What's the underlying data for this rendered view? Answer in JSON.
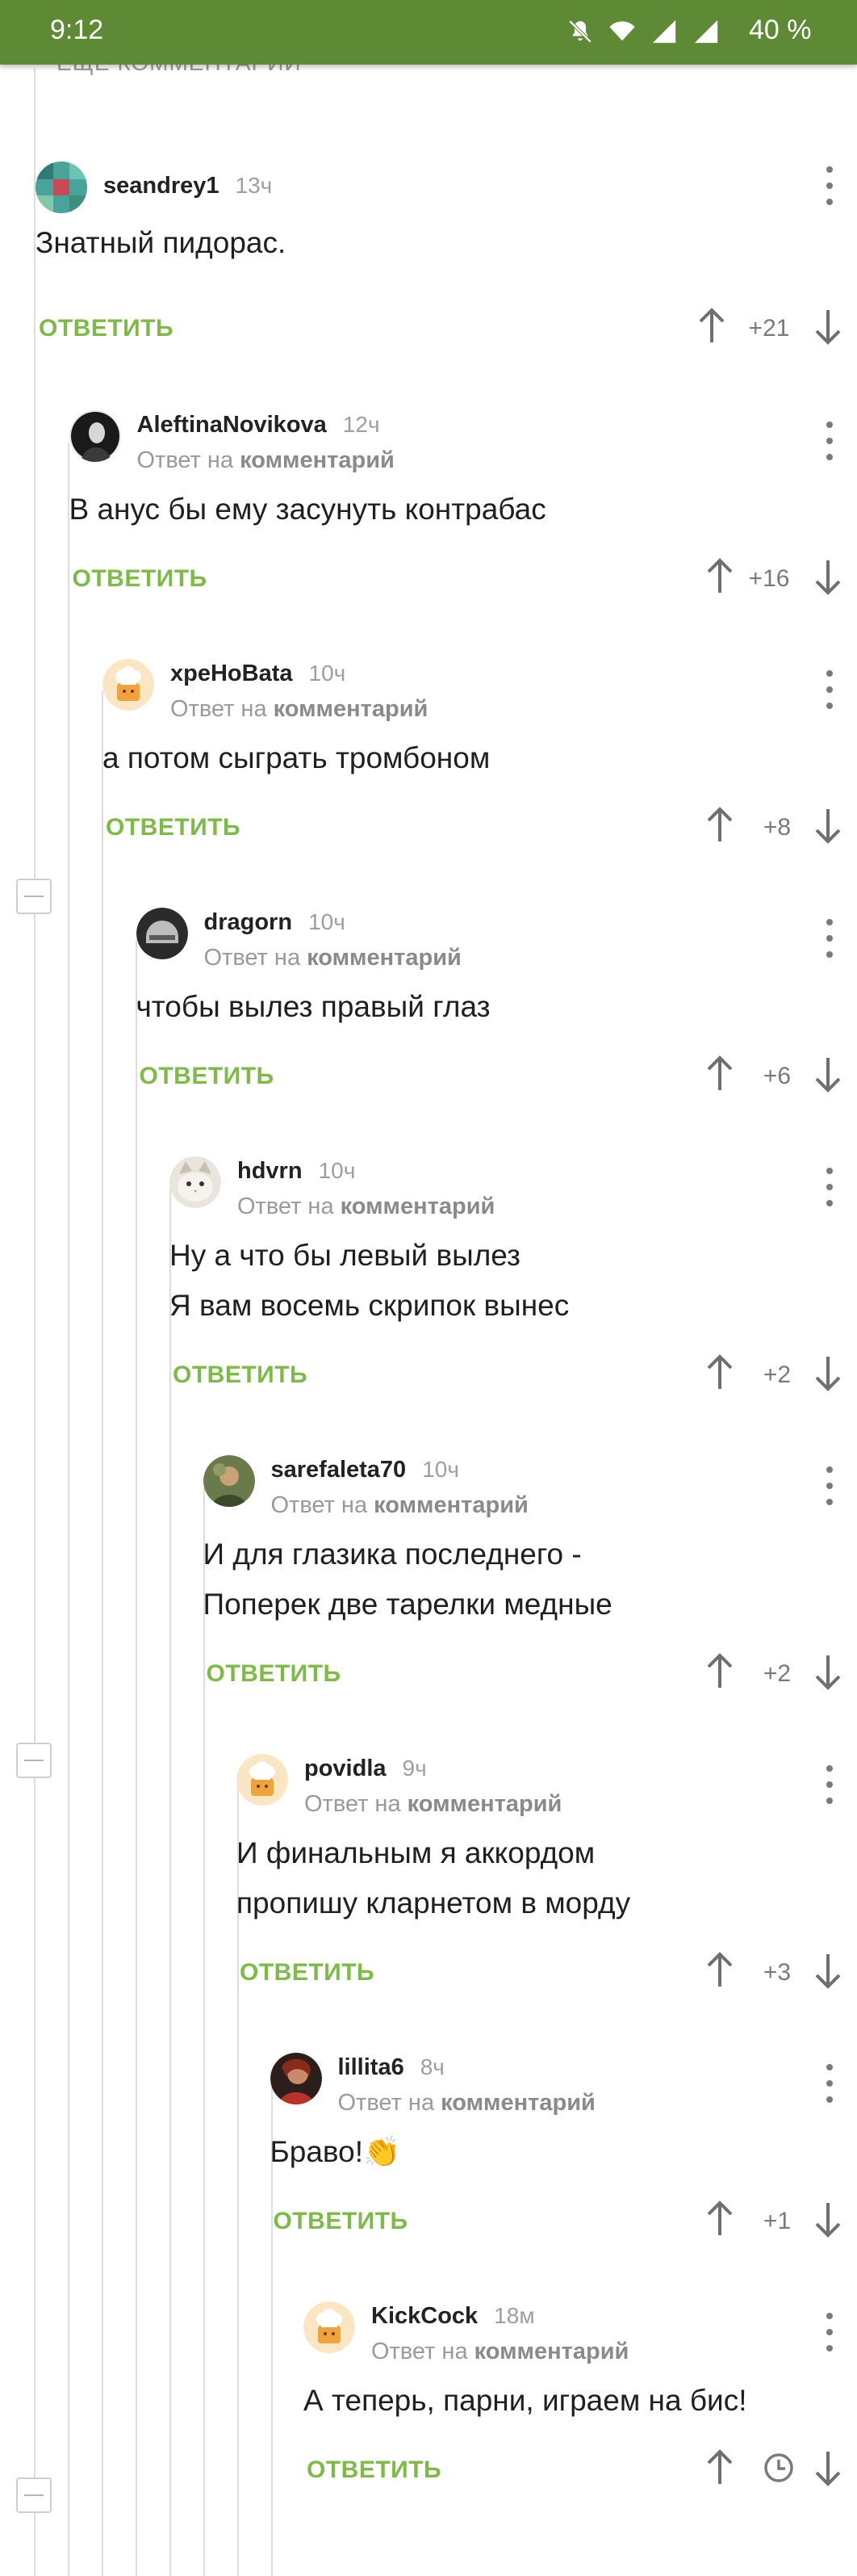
{
  "status_bar": {
    "time": "9:12",
    "battery": "40 %"
  },
  "previous": {
    "more_label": "ЕЩЕ КОММЕНТАРИИ"
  },
  "labels": {
    "reply": "ОТВЕТИТЬ",
    "reply_prefix": "Ответ на",
    "reply_target": "комментарий"
  },
  "colors": {
    "brand_green": "#5e8a35",
    "accent_green": "#7dbb46",
    "thread_line": "#dddddd"
  },
  "comments": [
    {
      "username": "seandrey1",
      "time": "13ч",
      "reply_to": false,
      "text": [
        "Знатный пидорас."
      ],
      "score": "+21",
      "avatar": "mosaic-avatar"
    },
    {
      "username": "AleftinaNovikova",
      "time": "12ч",
      "reply_to": true,
      "text": [
        "В анус бы ему засунуть контрабас"
      ],
      "score": "+16",
      "avatar": "dark-figure-avatar"
    },
    {
      "username": "xpeHoBata",
      "time": "10ч",
      "reply_to": true,
      "text": [
        "а потом сыграть тромбоном"
      ],
      "score": "+8",
      "avatar": "default-chef-avatar"
    },
    {
      "username": "dragorn",
      "time": "10ч",
      "reply_to": true,
      "text": [
        "чтобы вылез правый глаз"
      ],
      "score": "+6",
      "avatar": "helmet-avatar"
    },
    {
      "username": "hdvrn",
      "time": "10ч",
      "reply_to": true,
      "text": [
        "Ну а что бы левый вылез",
        "Я вам восемь скрипок вынес"
      ],
      "score": "+2",
      "avatar": "cat-avatar"
    },
    {
      "username": "sarefaleta70",
      "time": "10ч",
      "reply_to": true,
      "text": [
        "И для глазика последнего -",
        "Поперек две тарелки медные"
      ],
      "score": "+2",
      "avatar": "portrait-avatar"
    },
    {
      "username": "povidla",
      "time": "9ч",
      "reply_to": true,
      "text": [
        "И финальным я аккордом",
        "пропишу кларнетом в морду"
      ],
      "score": "+3",
      "avatar": "default-chef-avatar"
    },
    {
      "username": "lillita6",
      "time": "8ч",
      "reply_to": true,
      "text": [
        "Браво!👏"
      ],
      "score": "+1",
      "avatar": "red-portrait-avatar"
    },
    {
      "username": "KickCock",
      "time": "18м",
      "reply_to": true,
      "text": [
        "А теперь, парни, играем на бис!"
      ],
      "score": "",
      "pending": true,
      "avatar": "default-chef-avatar"
    }
  ]
}
